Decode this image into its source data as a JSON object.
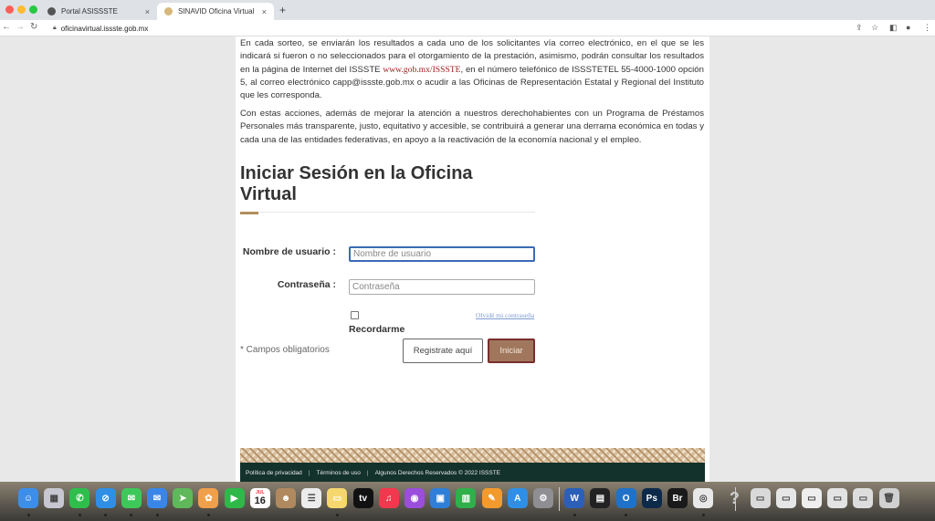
{
  "browser": {
    "tabs": [
      {
        "label": "Portal ASISSSTE",
        "active": false
      },
      {
        "label": "SINAVID Oficina Virtual",
        "active": true
      }
    ],
    "new_tab": "+",
    "close_symbol": "×",
    "url": "oficinavirtual.issste.gob.mx"
  },
  "content": {
    "para1_before": "En cada sorteo, se enviarán los resultados a cada uno de los solicitantes vía correo electrónico, en el que se les indicará si fueron o no seleccionados para el otorgamiento de la prestación, asimismo, podrán consultar los resultados en la página de Internet del ISSSTE ",
    "para1_link": "www.gob.mx/ISSSTE",
    "para1_after": ", en el número telefónico de ISSSTETEL 55-4000-1000 opción 5, al correo electrónico capp@issste.gob.mx o acudir a las Oficinas de Representación Estatal y Regional del Instituto que les corresponda.",
    "para2": "Con estas acciones, además de mejorar la atención a nuestros derechohabientes con un Programa de Préstamos Personales más transparente, justo, equitativo y accesible, se contribuirá a generar una derrama económica en todas y cada una de las entidades federativas, en apoyo a la reactivación de la economía nacional y el empleo."
  },
  "login": {
    "title": "Iniciar Sesión en la Oficina Virtual",
    "username_label": "Nombre de usuario :",
    "username_placeholder": "Nombre de usuario",
    "username_value": "",
    "password_label": "Contraseña :",
    "password_placeholder": "Contraseña",
    "password_value": "",
    "remember_label": "Recordarme",
    "remember_checked": false,
    "forgot_link": "Olvidé mi contraseña",
    "required_note": "* Campos obligatorios",
    "register_button": "Registrate aquí",
    "login_button": "Iniciar"
  },
  "footer": {
    "links": [
      "Política de privacidad",
      "Términos de uso"
    ],
    "separator": "|",
    "rights": "Algunos Derechos Reservados © 2022 ISSSTE"
  },
  "dock": {
    "calendar_month": "JUL",
    "calendar_day": "16",
    "apps": [
      {
        "name": "finder",
        "color": "#3d8ee8",
        "glyph": "☺"
      },
      {
        "name": "launchpad",
        "color": "#c7c7d1",
        "glyph": "▦"
      },
      {
        "name": "whatsapp",
        "color": "#2fbe4c",
        "glyph": "✆"
      },
      {
        "name": "safari",
        "color": "#2f8fe6",
        "glyph": "⊘"
      },
      {
        "name": "messages",
        "color": "#3fc85a",
        "glyph": "✉"
      },
      {
        "name": "mail",
        "color": "#3a86e8",
        "glyph": "✉"
      },
      {
        "name": "maps",
        "color": "#5fb85a",
        "glyph": "➤"
      },
      {
        "name": "photos",
        "color": "#f0a04b",
        "glyph": "✿"
      },
      {
        "name": "facetime",
        "color": "#2fb84a",
        "glyph": "▶"
      },
      {
        "name": "calendar",
        "color": "#ffffff",
        "glyph": ""
      },
      {
        "name": "contacts",
        "color": "#b08a5e",
        "glyph": "☻"
      },
      {
        "name": "reminders",
        "color": "#ececec",
        "glyph": "☰"
      },
      {
        "name": "notes",
        "color": "#f5d76e",
        "glyph": "▭"
      },
      {
        "name": "apple-tv",
        "color": "#111111",
        "glyph": "tv"
      },
      {
        "name": "music",
        "color": "#f0394e",
        "glyph": "♫"
      },
      {
        "name": "podcasts",
        "color": "#9b4ddc",
        "glyph": "◉"
      },
      {
        "name": "keynote",
        "color": "#2f7fd8",
        "glyph": "▣"
      },
      {
        "name": "numbers",
        "color": "#2fb04a",
        "glyph": "▥"
      },
      {
        "name": "pages",
        "color": "#f29a2e",
        "glyph": "✎"
      },
      {
        "name": "app-store",
        "color": "#2f8fe6",
        "glyph": "A"
      },
      {
        "name": "system-preferences",
        "color": "#8e8e93",
        "glyph": "⚙"
      },
      {
        "name": "word",
        "color": "#2b5fb8",
        "glyph": "W"
      },
      {
        "name": "activity-monitor",
        "color": "#222222",
        "glyph": "▤"
      },
      {
        "name": "outlook",
        "color": "#1f72c8",
        "glyph": "O"
      },
      {
        "name": "photoshop",
        "color": "#0d2a4a",
        "glyph": "Ps"
      },
      {
        "name": "bridge",
        "color": "#1a1a1a",
        "glyph": "Br"
      },
      {
        "name": "chrome",
        "color": "#e8e8e8",
        "glyph": "◎"
      },
      {
        "name": "help",
        "color": "transparent",
        "glyph": "?"
      },
      {
        "name": "window-thumb-1",
        "color": "#d9d9d9",
        "glyph": "▭"
      },
      {
        "name": "window-thumb-2",
        "color": "#e6e6e6",
        "glyph": "▭"
      },
      {
        "name": "window-thumb-3",
        "color": "#eeeeee",
        "glyph": "▭"
      },
      {
        "name": "window-thumb-4",
        "color": "#e3e3e3",
        "glyph": "▭"
      },
      {
        "name": "window-thumb-5",
        "color": "#dddddd",
        "glyph": "▭"
      },
      {
        "name": "trash",
        "color": "#d0d0d0",
        "glyph": "🗑"
      }
    ]
  },
  "colors": {
    "accent": "#b38e5d",
    "login_button_bg": "#a0775c",
    "footer_bg": "#13322b",
    "link_red": "#9a1a1a",
    "focus_blue": "#3b6bb5"
  }
}
